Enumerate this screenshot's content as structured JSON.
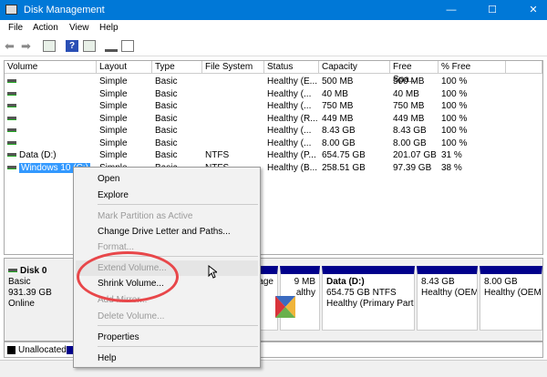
{
  "window": {
    "title": "Disk Management",
    "minimize": "—",
    "maximize": "☐",
    "close": "✕"
  },
  "menu": [
    "File",
    "Action",
    "View",
    "Help"
  ],
  "toolbar": {
    "icons": [
      "back-icon",
      "forward-icon",
      "console-tree-icon",
      "help-icon",
      "show-pane-icon",
      "connect-icon",
      "properties-icon"
    ]
  },
  "table": {
    "headers": [
      "Volume",
      "Layout",
      "Type",
      "File System",
      "Status",
      "Capacity",
      "Free Spa...",
      "% Free"
    ],
    "rows": [
      [
        "",
        "Simple",
        "Basic",
        "",
        "Healthy (E...",
        "500 MB",
        "500 MB",
        "100 %"
      ],
      [
        "",
        "Simple",
        "Basic",
        "",
        "Healthy (...",
        "40 MB",
        "40 MB",
        "100 %"
      ],
      [
        "",
        "Simple",
        "Basic",
        "",
        "Healthy (...",
        "750 MB",
        "750 MB",
        "100 %"
      ],
      [
        "",
        "Simple",
        "Basic",
        "",
        "Healthy (R...",
        "449 MB",
        "449 MB",
        "100 %"
      ],
      [
        "",
        "Simple",
        "Basic",
        "",
        "Healthy (...",
        "8.43 GB",
        "8.43 GB",
        "100 %"
      ],
      [
        "",
        "Simple",
        "Basic",
        "",
        "Healthy (...",
        "8.00 GB",
        "8.00 GB",
        "100 %"
      ],
      [
        "Data (D:)",
        "Simple",
        "Basic",
        "NTFS",
        "Healthy (P...",
        "654.75 GB",
        "201.07 GB",
        "31 %"
      ],
      [
        "Windows 10 (C:)",
        "Simple",
        "Basic",
        "NTFS",
        "Healthy (B...",
        "258.51 GB",
        "97.39 GB",
        "38 %"
      ]
    ]
  },
  "disk": {
    "name": "Disk 0",
    "type": "Basic",
    "size": "931.39 GB",
    "state": "Online",
    "partitions": [
      {
        "l1": "",
        "l2": "",
        "l3": "age"
      },
      {
        "l1": "",
        "l2": "9 MB",
        "l3": "althy"
      },
      {
        "l1": "Data  (D:)",
        "l2": "654.75 GB NTFS",
        "l3": "Healthy (Primary Part"
      },
      {
        "l1": "",
        "l2": "8.43 GB",
        "l3": "Healthy (OEM"
      },
      {
        "l1": "",
        "l2": "8.00 GB",
        "l3": "Healthy (OEM"
      }
    ]
  },
  "legend": {
    "unallocated": "Unallocated"
  },
  "context_menu": {
    "items": [
      {
        "label": "Open",
        "enabled": true
      },
      {
        "label": "Explore",
        "enabled": true
      },
      {
        "label": "Mark Partition as Active",
        "enabled": false
      },
      {
        "label": "Change Drive Letter and Paths...",
        "enabled": true
      },
      {
        "label": "Format...",
        "enabled": false
      },
      {
        "label": "Extend Volume...",
        "enabled": false,
        "hovered": true
      },
      {
        "label": "Shrink Volume...",
        "enabled": true
      },
      {
        "label": "Add Mirror...",
        "enabled": false
      },
      {
        "label": "Delete Volume...",
        "enabled": false
      },
      {
        "label": "Properties",
        "enabled": true
      },
      {
        "label": "Help",
        "enabled": true
      }
    ]
  },
  "colors": {
    "titlebar": "#0078d7",
    "partition_header": "#00008b",
    "selection": "#3399ff",
    "highlight_circle": "#e8474a"
  }
}
